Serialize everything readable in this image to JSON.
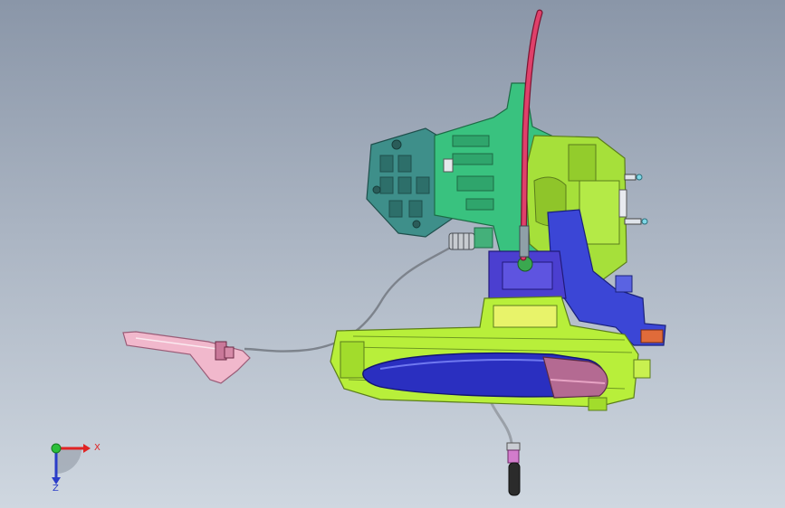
{
  "viewport": {
    "background_top": "#8a96a8",
    "background_bottom": "#cfd7e0"
  },
  "model": {
    "parts": [
      {
        "name": "pink-cable-rod",
        "color": "#e0406a"
      },
      {
        "name": "teal-gearbox-bracket",
        "color": "#3e8f8a"
      },
      {
        "name": "green-frame",
        "color": "#39c27f"
      },
      {
        "name": "lime-actuator-housing",
        "color": "#a6e03a"
      },
      {
        "name": "blue-lever-bracket",
        "color": "#3b46d6"
      },
      {
        "name": "lime-handle-base",
        "color": "#b8ef3a"
      },
      {
        "name": "blue-handle",
        "color": "#2a2fc0"
      },
      {
        "name": "pink-handle-cap",
        "color": "#b46a92"
      },
      {
        "name": "pink-trim-piece",
        "color": "#f1b8cc"
      },
      {
        "name": "grey-bowden-cable",
        "color": "#8d939b"
      },
      {
        "name": "black-cable-end",
        "color": "#2b2b2b"
      }
    ]
  },
  "triad": {
    "x_label": "X",
    "z_label": "Z",
    "x_color": "#e02424",
    "z_color": "#2a3cc8",
    "y_color": "#2bbf3a"
  }
}
